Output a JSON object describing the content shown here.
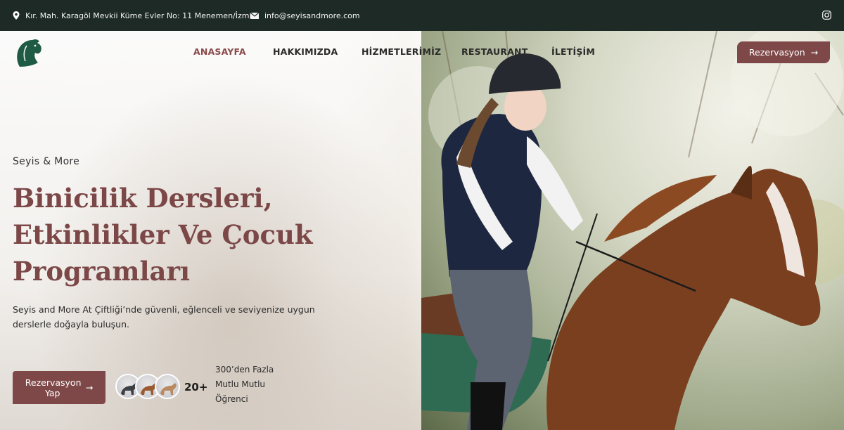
{
  "topbar": {
    "address": "Kır. Mah. Karagöl Mevkii Küme Evler No: 11 Menemen/İzmir",
    "email": "info@seyisandmore.com",
    "icons": {
      "address": "map-pin-icon",
      "email": "envelope-icon",
      "social": "instagram-icon"
    }
  },
  "nav": {
    "items": [
      {
        "label": "ANASAYFA",
        "active": true
      },
      {
        "label": "HAKKIMIZDA",
        "active": false
      },
      {
        "label": "HİZMETLERİMİZ",
        "active": false
      },
      {
        "label": "RESTAURANT",
        "active": false
      },
      {
        "label": "İLETİŞİM",
        "active": false
      }
    ],
    "reserve_label": "Rezervasyon",
    "arrow": "→"
  },
  "hero": {
    "eyebrow": "Seyis & More",
    "headline": [
      "Binicilik Dersleri,",
      "Etkinlikler Ve Çocuk",
      "Programları"
    ],
    "description": "Seyis and More At Çiftliği’nde güvenli, eğlenceli ve seviyenize uygun derslerle doğayla buluşun.",
    "cta_label": "Rezervasyon Yap",
    "cta_arrow": "→",
    "count": "20+",
    "students_text": "300’den Fazla Mutlu Mutlu Öğrenci"
  },
  "colors": {
    "topbar": "#1e2a25",
    "accent": "#7f4848",
    "logo": "#1f5a45",
    "nav_active": "#8a4a4a"
  }
}
